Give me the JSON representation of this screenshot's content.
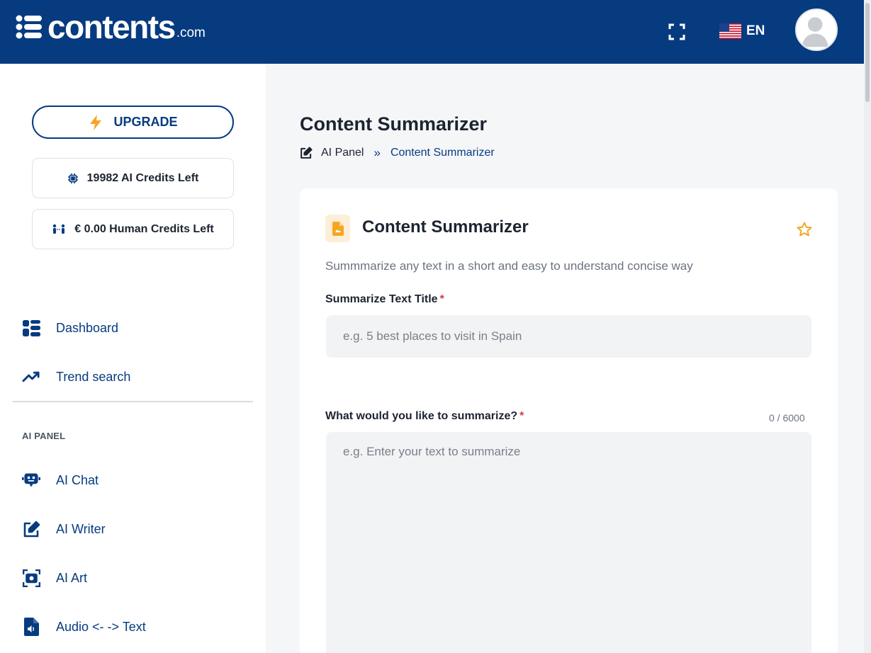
{
  "header": {
    "logo": {
      "text": "contents",
      "tld": ".com"
    },
    "fullscreen_icon": "fullscreen-icon",
    "language": {
      "flag": "us-flag-icon",
      "label": "EN"
    },
    "avatar": "user-avatar"
  },
  "sidebar": {
    "upgrade_label": "UPGRADE",
    "ai_credits": "19982 AI Credits Left",
    "human_credits": "€ 0.00 Human Credits Left",
    "nav_items": [
      {
        "label": "Dashboard",
        "icon": "dashboard-icon"
      },
      {
        "label": "Trend search",
        "icon": "trend-icon"
      }
    ],
    "section_label": "AI PANEL",
    "ai_items": [
      {
        "label": "AI Chat",
        "icon": "robot-icon"
      },
      {
        "label": "AI Writer",
        "icon": "edit-icon"
      },
      {
        "label": "AI Art",
        "icon": "camera-icon"
      },
      {
        "label": "Audio <- -> Text",
        "icon": "audio-file-icon"
      }
    ]
  },
  "main": {
    "page_title": "Content Summarizer",
    "breadcrumb": {
      "home": "AI Panel",
      "separator": "»",
      "current": "Content Summarizer"
    },
    "card": {
      "title": "Content Summarizer",
      "description": "Summmarize any text in a short and easy to understand concise way",
      "title_field": {
        "label": "Summarize Text Title",
        "required": "*",
        "placeholder": "e.g. 5 best places to visit in Spain",
        "value": ""
      },
      "text_field": {
        "label": "What would you like to summarize?",
        "required": "*",
        "placeholder": "e.g. Enter your text to summarize",
        "value": "",
        "counter": "0 / 6000"
      }
    }
  },
  "colors": {
    "brand": "#063b80",
    "accent": "#f5a623",
    "required": "#d93a4a"
  }
}
